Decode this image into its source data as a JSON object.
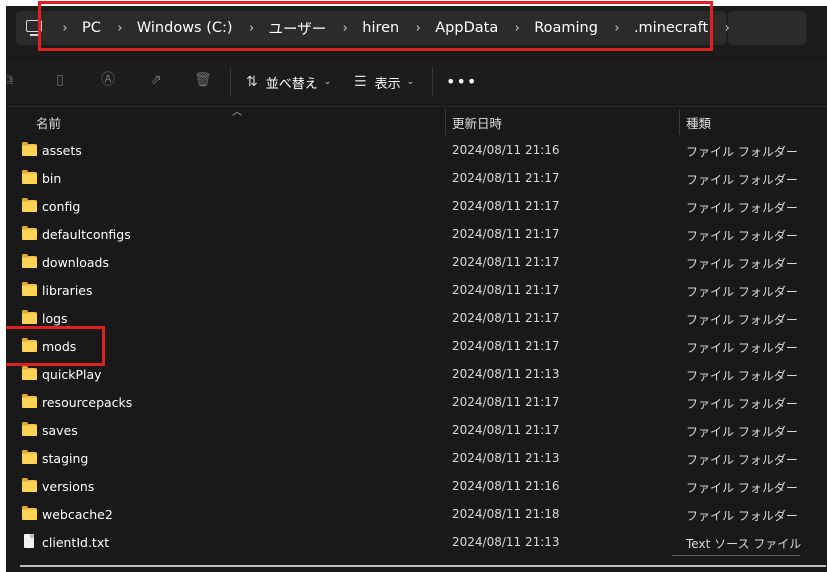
{
  "address_bar": {
    "icon": "pc-icon",
    "crumbs": [
      "PC",
      "Windows (C:)",
      "ユーザー",
      "hiren",
      "AppData",
      "Roaming",
      ".minecraft"
    ],
    "separator": "›"
  },
  "toolbar": {
    "icons": [
      "copy-icon",
      "paste-icon",
      "rename-icon",
      "share-icon",
      "delete-icon"
    ],
    "sort_label": "並べ替え",
    "view_label": "表示",
    "more_label": "•••"
  },
  "columns": {
    "name": "名前",
    "date": "更新日時",
    "type": "種類"
  },
  "items": [
    {
      "name": "assets",
      "date": "2024/08/11 21:16",
      "type": "ファイル フォルダー",
      "kind": "folder"
    },
    {
      "name": "bin",
      "date": "2024/08/11 21:17",
      "type": "ファイル フォルダー",
      "kind": "folder"
    },
    {
      "name": "config",
      "date": "2024/08/11 21:17",
      "type": "ファイル フォルダー",
      "kind": "folder"
    },
    {
      "name": "defaultconfigs",
      "date": "2024/08/11 21:17",
      "type": "ファイル フォルダー",
      "kind": "folder"
    },
    {
      "name": "downloads",
      "date": "2024/08/11 21:17",
      "type": "ファイル フォルダー",
      "kind": "folder"
    },
    {
      "name": "libraries",
      "date": "2024/08/11 21:17",
      "type": "ファイル フォルダー",
      "kind": "folder"
    },
    {
      "name": "logs",
      "date": "2024/08/11 21:17",
      "type": "ファイル フォルダー",
      "kind": "folder"
    },
    {
      "name": "mods",
      "date": "2024/08/11 21:17",
      "type": "ファイル フォルダー",
      "kind": "folder"
    },
    {
      "name": "quickPlay",
      "date": "2024/08/11 21:13",
      "type": "ファイル フォルダー",
      "kind": "folder"
    },
    {
      "name": "resourcepacks",
      "date": "2024/08/11 21:17",
      "type": "ファイル フォルダー",
      "kind": "folder"
    },
    {
      "name": "saves",
      "date": "2024/08/11 21:17",
      "type": "ファイル フォルダー",
      "kind": "folder"
    },
    {
      "name": "staging",
      "date": "2024/08/11 21:13",
      "type": "ファイル フォルダー",
      "kind": "folder"
    },
    {
      "name": "versions",
      "date": "2024/08/11 21:16",
      "type": "ファイル フォルダー",
      "kind": "folder"
    },
    {
      "name": "webcache2",
      "date": "2024/08/11 21:18",
      "type": "ファイル フォルダー",
      "kind": "folder"
    },
    {
      "name": "clientId.txt",
      "date": "2024/08/11 21:13",
      "type": "Text ソース ファイル",
      "kind": "file"
    }
  ],
  "colors": {
    "background": "#191919",
    "highlight": "#e02020",
    "folder": "#ffd455"
  }
}
